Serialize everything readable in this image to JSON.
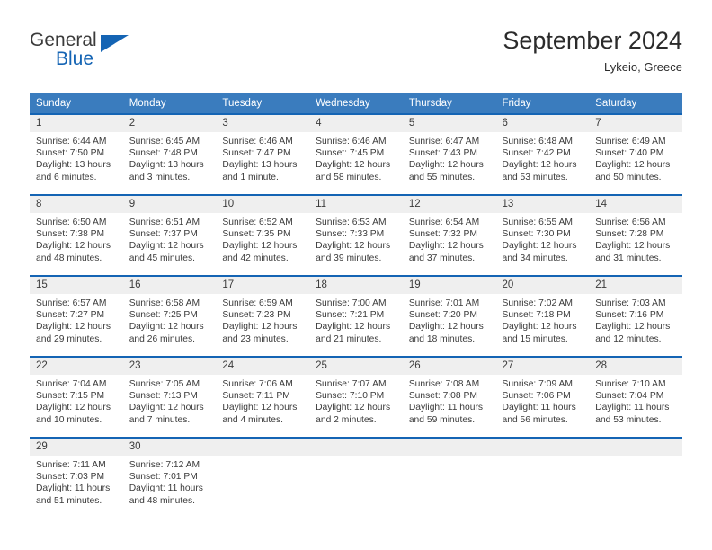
{
  "brand": {
    "name_part1": "General",
    "name_part2": "Blue",
    "logo_icon": "triangle-flag-icon",
    "accent_color": "#1464b4"
  },
  "header": {
    "month_title": "September 2024",
    "location": "Lykeio, Greece"
  },
  "theme": {
    "header_blue": "#3a7cbe",
    "rule_blue": "#1464b4",
    "day_band_gray": "#efefef",
    "text": "#3b3b3b"
  },
  "calendar": {
    "weekday_headers": [
      "Sunday",
      "Monday",
      "Tuesday",
      "Wednesday",
      "Thursday",
      "Friday",
      "Saturday"
    ],
    "weeks": [
      [
        {
          "day": "1",
          "sunrise": "Sunrise: 6:44 AM",
          "sunset": "Sunset: 7:50 PM",
          "daylight": "Daylight: 13 hours and 6 minutes."
        },
        {
          "day": "2",
          "sunrise": "Sunrise: 6:45 AM",
          "sunset": "Sunset: 7:48 PM",
          "daylight": "Daylight: 13 hours and 3 minutes."
        },
        {
          "day": "3",
          "sunrise": "Sunrise: 6:46 AM",
          "sunset": "Sunset: 7:47 PM",
          "daylight": "Daylight: 13 hours and 1 minute."
        },
        {
          "day": "4",
          "sunrise": "Sunrise: 6:46 AM",
          "sunset": "Sunset: 7:45 PM",
          "daylight": "Daylight: 12 hours and 58 minutes."
        },
        {
          "day": "5",
          "sunrise": "Sunrise: 6:47 AM",
          "sunset": "Sunset: 7:43 PM",
          "daylight": "Daylight: 12 hours and 55 minutes."
        },
        {
          "day": "6",
          "sunrise": "Sunrise: 6:48 AM",
          "sunset": "Sunset: 7:42 PM",
          "daylight": "Daylight: 12 hours and 53 minutes."
        },
        {
          "day": "7",
          "sunrise": "Sunrise: 6:49 AM",
          "sunset": "Sunset: 7:40 PM",
          "daylight": "Daylight: 12 hours and 50 minutes."
        }
      ],
      [
        {
          "day": "8",
          "sunrise": "Sunrise: 6:50 AM",
          "sunset": "Sunset: 7:38 PM",
          "daylight": "Daylight: 12 hours and 48 minutes."
        },
        {
          "day": "9",
          "sunrise": "Sunrise: 6:51 AM",
          "sunset": "Sunset: 7:37 PM",
          "daylight": "Daylight: 12 hours and 45 minutes."
        },
        {
          "day": "10",
          "sunrise": "Sunrise: 6:52 AM",
          "sunset": "Sunset: 7:35 PM",
          "daylight": "Daylight: 12 hours and 42 minutes."
        },
        {
          "day": "11",
          "sunrise": "Sunrise: 6:53 AM",
          "sunset": "Sunset: 7:33 PM",
          "daylight": "Daylight: 12 hours and 39 minutes."
        },
        {
          "day": "12",
          "sunrise": "Sunrise: 6:54 AM",
          "sunset": "Sunset: 7:32 PM",
          "daylight": "Daylight: 12 hours and 37 minutes."
        },
        {
          "day": "13",
          "sunrise": "Sunrise: 6:55 AM",
          "sunset": "Sunset: 7:30 PM",
          "daylight": "Daylight: 12 hours and 34 minutes."
        },
        {
          "day": "14",
          "sunrise": "Sunrise: 6:56 AM",
          "sunset": "Sunset: 7:28 PM",
          "daylight": "Daylight: 12 hours and 31 minutes."
        }
      ],
      [
        {
          "day": "15",
          "sunrise": "Sunrise: 6:57 AM",
          "sunset": "Sunset: 7:27 PM",
          "daylight": "Daylight: 12 hours and 29 minutes."
        },
        {
          "day": "16",
          "sunrise": "Sunrise: 6:58 AM",
          "sunset": "Sunset: 7:25 PM",
          "daylight": "Daylight: 12 hours and 26 minutes."
        },
        {
          "day": "17",
          "sunrise": "Sunrise: 6:59 AM",
          "sunset": "Sunset: 7:23 PM",
          "daylight": "Daylight: 12 hours and 23 minutes."
        },
        {
          "day": "18",
          "sunrise": "Sunrise: 7:00 AM",
          "sunset": "Sunset: 7:21 PM",
          "daylight": "Daylight: 12 hours and 21 minutes."
        },
        {
          "day": "19",
          "sunrise": "Sunrise: 7:01 AM",
          "sunset": "Sunset: 7:20 PM",
          "daylight": "Daylight: 12 hours and 18 minutes."
        },
        {
          "day": "20",
          "sunrise": "Sunrise: 7:02 AM",
          "sunset": "Sunset: 7:18 PM",
          "daylight": "Daylight: 12 hours and 15 minutes."
        },
        {
          "day": "21",
          "sunrise": "Sunrise: 7:03 AM",
          "sunset": "Sunset: 7:16 PM",
          "daylight": "Daylight: 12 hours and 12 minutes."
        }
      ],
      [
        {
          "day": "22",
          "sunrise": "Sunrise: 7:04 AM",
          "sunset": "Sunset: 7:15 PM",
          "daylight": "Daylight: 12 hours and 10 minutes."
        },
        {
          "day": "23",
          "sunrise": "Sunrise: 7:05 AM",
          "sunset": "Sunset: 7:13 PM",
          "daylight": "Daylight: 12 hours and 7 minutes."
        },
        {
          "day": "24",
          "sunrise": "Sunrise: 7:06 AM",
          "sunset": "Sunset: 7:11 PM",
          "daylight": "Daylight: 12 hours and 4 minutes."
        },
        {
          "day": "25",
          "sunrise": "Sunrise: 7:07 AM",
          "sunset": "Sunset: 7:10 PM",
          "daylight": "Daylight: 12 hours and 2 minutes."
        },
        {
          "day": "26",
          "sunrise": "Sunrise: 7:08 AM",
          "sunset": "Sunset: 7:08 PM",
          "daylight": "Daylight: 11 hours and 59 minutes."
        },
        {
          "day": "27",
          "sunrise": "Sunrise: 7:09 AM",
          "sunset": "Sunset: 7:06 PM",
          "daylight": "Daylight: 11 hours and 56 minutes."
        },
        {
          "day": "28",
          "sunrise": "Sunrise: 7:10 AM",
          "sunset": "Sunset: 7:04 PM",
          "daylight": "Daylight: 11 hours and 53 minutes."
        }
      ],
      [
        {
          "day": "29",
          "sunrise": "Sunrise: 7:11 AM",
          "sunset": "Sunset: 7:03 PM",
          "daylight": "Daylight: 11 hours and 51 minutes."
        },
        {
          "day": "30",
          "sunrise": "Sunrise: 7:12 AM",
          "sunset": "Sunset: 7:01 PM",
          "daylight": "Daylight: 11 hours and 48 minutes."
        },
        {
          "day": "",
          "sunrise": "",
          "sunset": "",
          "daylight": ""
        },
        {
          "day": "",
          "sunrise": "",
          "sunset": "",
          "daylight": ""
        },
        {
          "day": "",
          "sunrise": "",
          "sunset": "",
          "daylight": ""
        },
        {
          "day": "",
          "sunrise": "",
          "sunset": "",
          "daylight": ""
        },
        {
          "day": "",
          "sunrise": "",
          "sunset": "",
          "daylight": ""
        }
      ]
    ]
  }
}
